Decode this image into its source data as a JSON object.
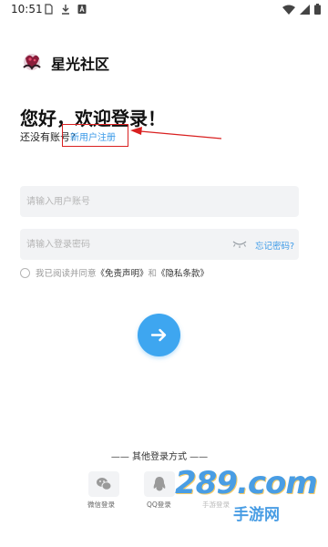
{
  "status_bar": {
    "time": "10:51"
  },
  "app": {
    "name": "星光社区",
    "logo_icon": "star-community-logo",
    "accent_color": "#3ea6f0"
  },
  "login": {
    "greeting": "您好，欢迎登录！",
    "no_account_text": "还没有账号?",
    "register_link": "新用户注册",
    "username_placeholder": "请输入用户账号",
    "password_placeholder": "请输入登录密码",
    "forgot_password": "忘记密码?",
    "agreement": {
      "prefix": "我已阅读并同意",
      "disclaimer": "《免责声明》",
      "and": "和",
      "privacy": "《隐私条款》"
    },
    "submit_icon": "arrow-right-icon"
  },
  "other_login": {
    "title": "—— 其他登录方式 ——",
    "options": [
      {
        "label": "微信登录",
        "icon": "wechat-icon"
      },
      {
        "label": "QQ登录",
        "icon": "qq-icon"
      },
      {
        "label": "手游登录",
        "icon": "game-icon"
      }
    ]
  },
  "annotation": {
    "highlight_color": "#d92020"
  },
  "watermark": {
    "main": "289.com",
    "sub": "手游网"
  }
}
